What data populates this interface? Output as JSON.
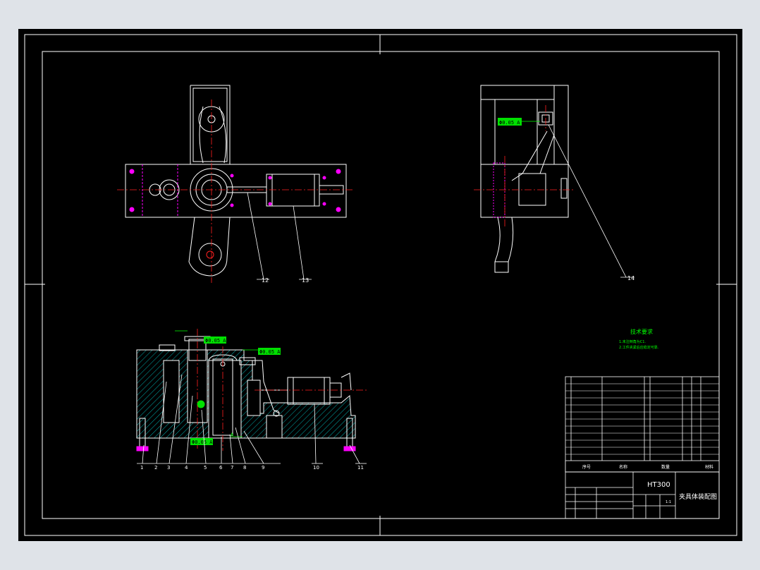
{
  "drawing": {
    "top_view": {
      "callouts": [
        "12",
        "13"
      ]
    },
    "side_view": {
      "callouts": [
        "14"
      ],
      "tolerance_tag": "Φ0.05 A"
    },
    "section_view": {
      "callouts": [
        "1",
        "2",
        "3",
        "4",
        "5",
        "6",
        "7",
        "8",
        "9",
        "10",
        "11"
      ],
      "tolerance_tags": [
        "Φ0.05 A",
        "Φ0.05 A",
        "Φ0.05 A"
      ],
      "datum_label": "A"
    },
    "tech_requirements": {
      "title": "技术要求",
      "lines": [
        "1.未注倒角为C1.",
        "2.工件夹紧后应稳定可靠."
      ]
    },
    "title_block": {
      "material": "HT300",
      "drawing_name": "夹具体装配图",
      "scale": "1:1",
      "bom_headers": [
        "序号",
        "名称",
        "数量",
        "材料"
      ]
    }
  },
  "colors": {
    "background": "#000000",
    "frame": "#ffffff",
    "centerline": "#ff2020",
    "hatch": "#00b0b0",
    "tag_fill": "#00e000",
    "magenta": "#ff00ff",
    "dim_green": "#00ff00"
  }
}
